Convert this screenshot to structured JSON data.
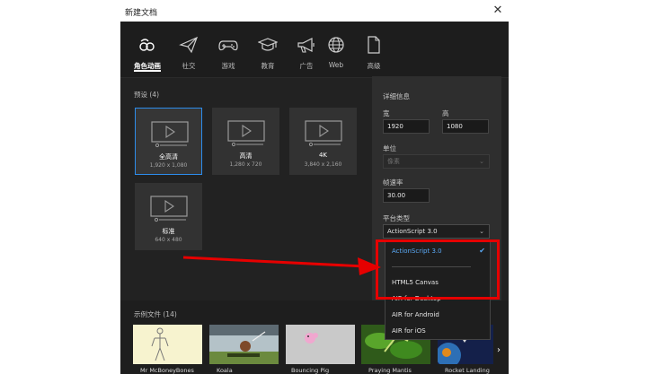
{
  "window": {
    "title": "新建文档"
  },
  "tabs": [
    {
      "label": "角色动画",
      "icon": "character-animation-icon",
      "active": true
    },
    {
      "label": "社交",
      "icon": "paper-plane-icon",
      "active": false
    },
    {
      "label": "游戏",
      "icon": "gamepad-icon",
      "active": false
    },
    {
      "label": "教育",
      "icon": "graduation-cap-icon",
      "active": false
    },
    {
      "label": "广告",
      "icon": "megaphone-icon",
      "active": false
    },
    {
      "label": "Web",
      "icon": "globe-icon",
      "active": false
    },
    {
      "label": "高级",
      "icon": "document-icon",
      "active": false
    }
  ],
  "presets": {
    "title": "预设 (4)",
    "items": [
      {
        "name": "全高清",
        "size": "1,920 x 1,080",
        "selected": true
      },
      {
        "name": "高清",
        "size": "1,280 x 720",
        "selected": false
      },
      {
        "name": "4K",
        "size": "3,840 x 2,160",
        "selected": false
      },
      {
        "name": "标准",
        "size": "640 x 480",
        "selected": false
      }
    ]
  },
  "details": {
    "title": "详细信息",
    "width_label": "宽",
    "width_value": "1920",
    "height_label": "高",
    "height_value": "1080",
    "unit_label": "单位",
    "unit_value": "像素",
    "fps_label": "帧速率",
    "fps_value": "30.00",
    "platform_label": "平台类型",
    "platform_value": "ActionScript 3.0"
  },
  "platform_dropdown": {
    "options": [
      "ActionScript 3.0",
      "HTML5 Canvas",
      "AIR for Desktop",
      "AIR for Android",
      "AIR for iOS"
    ],
    "selected": "ActionScript 3.0"
  },
  "samples": {
    "title": "示例文件 (14)",
    "items": [
      "Mr McBoneyBones",
      "Koala",
      "Bouncing Pig",
      "Praying Mantis",
      "Rocket Landing"
    ]
  },
  "colors": {
    "accent": "#2d8ceb",
    "highlight": "#e60000",
    "check": "#5aa9f5"
  }
}
